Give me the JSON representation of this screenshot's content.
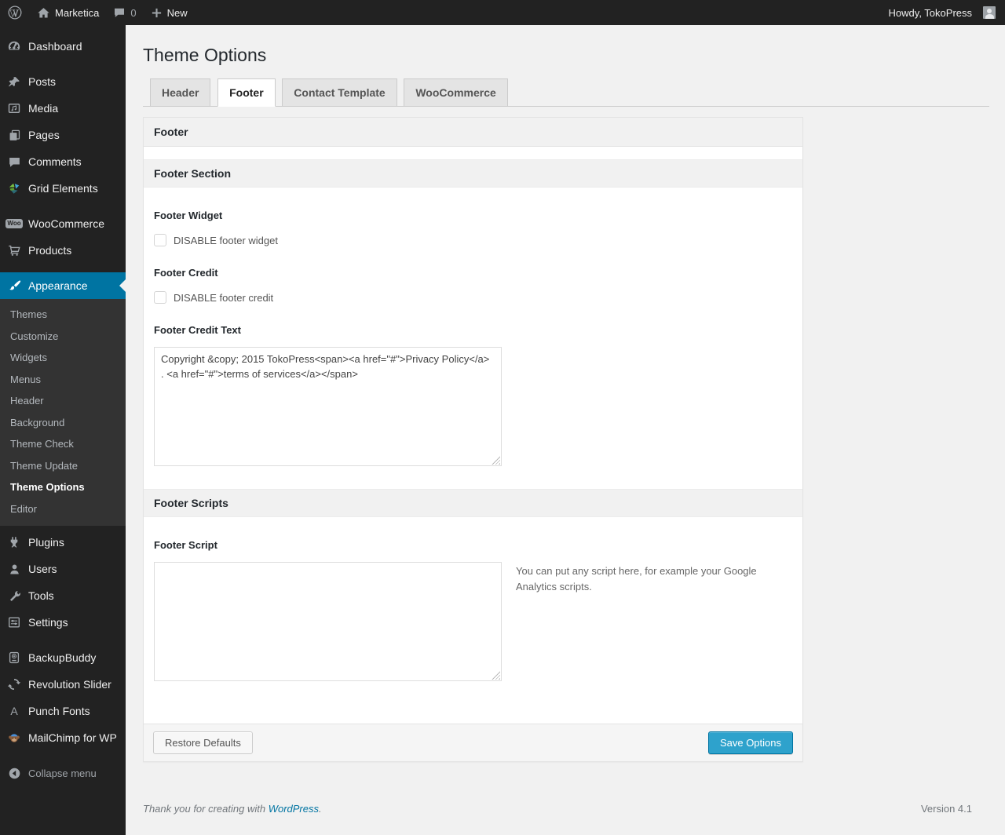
{
  "admin_bar": {
    "site_name": "Marketica",
    "comment_count": "0",
    "new_label": "New",
    "howdy": "Howdy, TokoPress"
  },
  "sidebar": {
    "items": [
      {
        "label": "Dashboard",
        "icon": "dashboard-icon"
      },
      {
        "label": "Posts",
        "icon": "pushpin-icon"
      },
      {
        "label": "Media",
        "icon": "media-icon"
      },
      {
        "label": "Pages",
        "icon": "pages-icon"
      },
      {
        "label": "Comments",
        "icon": "comment-icon"
      },
      {
        "label": "Grid Elements",
        "icon": "grid-elements-icon"
      },
      {
        "label": "WooCommerce",
        "icon": "woocommerce-badge-icon"
      },
      {
        "label": "Products",
        "icon": "cart-icon"
      },
      {
        "label": "Appearance",
        "icon": "brush-icon",
        "active": true
      },
      {
        "label": "Plugins",
        "icon": "plug-icon"
      },
      {
        "label": "Users",
        "icon": "user-icon"
      },
      {
        "label": "Tools",
        "icon": "wrench-icon"
      },
      {
        "label": "Settings",
        "icon": "settings-icon"
      },
      {
        "label": "BackupBuddy",
        "icon": "backup-icon"
      },
      {
        "label": "Revolution Slider",
        "icon": "refresh-icon"
      },
      {
        "label": "Punch Fonts",
        "icon": "letter-a-icon"
      },
      {
        "label": "MailChimp for WP",
        "icon": "monkey-icon"
      },
      {
        "label": "Collapse menu",
        "icon": "collapse-arrow-icon"
      }
    ],
    "appearance_submenu": [
      {
        "label": "Themes"
      },
      {
        "label": "Customize"
      },
      {
        "label": "Widgets"
      },
      {
        "label": "Menus"
      },
      {
        "label": "Header"
      },
      {
        "label": "Background"
      },
      {
        "label": "Theme Check"
      },
      {
        "label": "Theme Update"
      },
      {
        "label": "Theme Options",
        "current": true
      },
      {
        "label": "Editor"
      }
    ]
  },
  "page": {
    "title": "Theme Options",
    "tabs": [
      {
        "label": "Header",
        "active": false
      },
      {
        "label": "Footer",
        "active": true
      },
      {
        "label": "Contact Template",
        "active": false
      },
      {
        "label": "WooCommerce",
        "active": false
      }
    ]
  },
  "panel": {
    "header": "Footer",
    "footer_section_title": "Footer Section",
    "footer_widget_label": "Footer Widget",
    "footer_widget_checkbox_label": "DISABLE footer widget",
    "footer_credit_label": "Footer Credit",
    "footer_credit_checkbox_label": "DISABLE footer credit",
    "footer_credit_text_label": "Footer Credit Text",
    "footer_credit_text_value": "Copyright &copy; 2015 TokoPress<span><a href=\"#\">Privacy Policy</a> . <a href=\"#\">terms of services</a></span>",
    "footer_scripts_title": "Footer Scripts",
    "footer_script_label": "Footer Script",
    "footer_script_value": "",
    "footer_script_help": "You can put any script here, for example your Google Analytics scripts.",
    "restore_button_label": "Restore Defaults",
    "save_button_label": "Save Options"
  },
  "page_footer": {
    "thanks_prefix": "Thank you for creating with ",
    "wordpress_link": "WordPress",
    "suffix": ".",
    "version": "Version 4.1"
  },
  "icons": {
    "wordpress-logo-icon": "circled W glyph",
    "home-icon": "house shape",
    "comment-icon": "speech bubble",
    "plus-icon": "+",
    "dashboard-icon": "gauge",
    "pushpin-icon": "push pin",
    "media-icon": "frame with music note",
    "pages-icon": "stacked pages",
    "grid-elements-icon": "multicolor pinwheel grid",
    "woocommerce-badge-icon": "Woo badge",
    "cart-icon": "shopping cart",
    "brush-icon": "paint brush",
    "plug-icon": "power plug",
    "user-icon": "person silhouette",
    "wrench-icon": "wrench",
    "settings-icon": "slider panel",
    "backup-icon": "drive with plus",
    "refresh-icon": "circular arrows",
    "letter-a-icon": "A",
    "monkey-icon": "monkey face",
    "collapse-arrow-icon": "circle with left arrow",
    "avatar": "gray person avatar",
    "resize-grip-icon": "diagonal resize grip"
  },
  "colors": {
    "admin_bar_bg": "#222222",
    "sidebar_bg": "#222222",
    "submenu_bg": "#333333",
    "menu_active_bg": "#0074a2",
    "content_bg": "#f1f1f1",
    "accent_link": "#0074a2",
    "primary_button_bg": "#2ea2cc",
    "primary_button_border": "#0074a2"
  }
}
